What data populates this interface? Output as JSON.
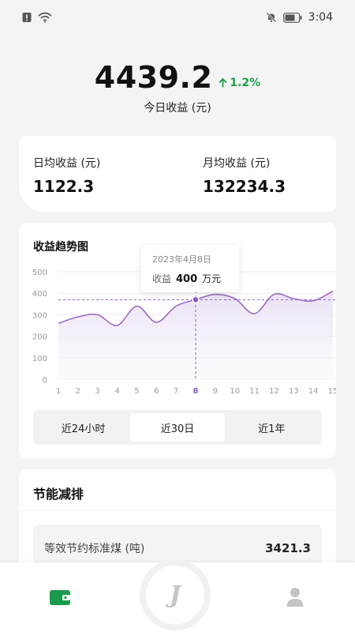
{
  "status_bar": {
    "time": "3:04"
  },
  "summary": {
    "value": "4439.2",
    "change": "1.2%",
    "label": "今日收益 (元)"
  },
  "stats": {
    "daily_label": "日均收益 (元)",
    "daily_value": "1122.3",
    "monthly_label": "月均收益 (元)",
    "monthly_value": "132234.3"
  },
  "chart_card": {
    "title": "收益趋势图",
    "tooltip": {
      "date": "2023年4月8日",
      "label": "收益",
      "value": "400",
      "unit": "万元"
    },
    "tabs": [
      "近24小时",
      "近30日",
      "近1年"
    ],
    "active_tab": 1
  },
  "chart_data": {
    "type": "area",
    "title": "收益趋势图",
    "x": [
      1,
      2,
      3,
      4,
      5,
      6,
      7,
      8,
      9,
      10,
      11,
      12,
      13,
      14,
      15
    ],
    "y": [
      260,
      290,
      300,
      250,
      340,
      265,
      340,
      370,
      395,
      375,
      305,
      395,
      375,
      365,
      410
    ],
    "ylim": [
      0,
      500
    ],
    "yticks": [
      0,
      100,
      200,
      300,
      400,
      500
    ],
    "highlight_x": 8,
    "grid": true,
    "colors": {
      "line": "#9b6cc4",
      "fill": "#ede4f6",
      "highlight": "#8a5cc0"
    }
  },
  "eco": {
    "title": "节能减排",
    "items": [
      {
        "label": "等效节约标准煤 (吨)",
        "value": "3421.3"
      }
    ]
  },
  "colors": {
    "positive": "#1e9e4a",
    "wallet": "#1b9a4b",
    "accent": "#9b6cc4"
  },
  "icons": {
    "tab_wallet": "wallet-icon",
    "tab_center": "logo-j-icon",
    "tab_profile": "person-icon"
  },
  "tab_bar": {
    "center_glyph": "J"
  }
}
